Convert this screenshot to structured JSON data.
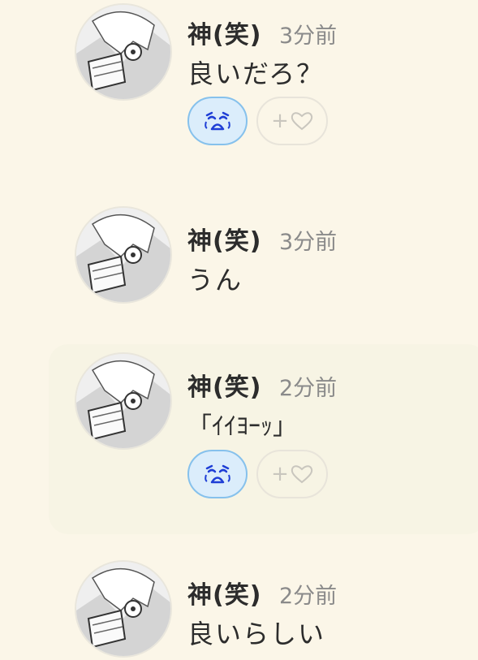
{
  "messages": [
    {
      "name": "神(笑)",
      "time": "3分前",
      "text": "良いだろ？",
      "reaction": "crying-face-emoji",
      "has_reaction": true
    },
    {
      "name": "神(笑)",
      "time": "3分前",
      "text": "うん",
      "has_reaction": false
    },
    {
      "name": "神(笑)",
      "time": "2分前",
      "text": "「ｲｲﾖｰｯ」",
      "reaction": "crying-face-emoji",
      "has_reaction": true,
      "highlighted": true
    },
    {
      "name": "神(笑)",
      "time": "2分前",
      "text": "良いらしい",
      "has_reaction": false
    }
  ],
  "add_reaction": {
    "plus": "+",
    "icon": "heart-outline-icon"
  },
  "colors": {
    "background": "#fbf6e8",
    "reaction_bg": "#dbedfb",
    "reaction_border": "#86c1ec",
    "emoji_blue": "#1f3fd6"
  }
}
